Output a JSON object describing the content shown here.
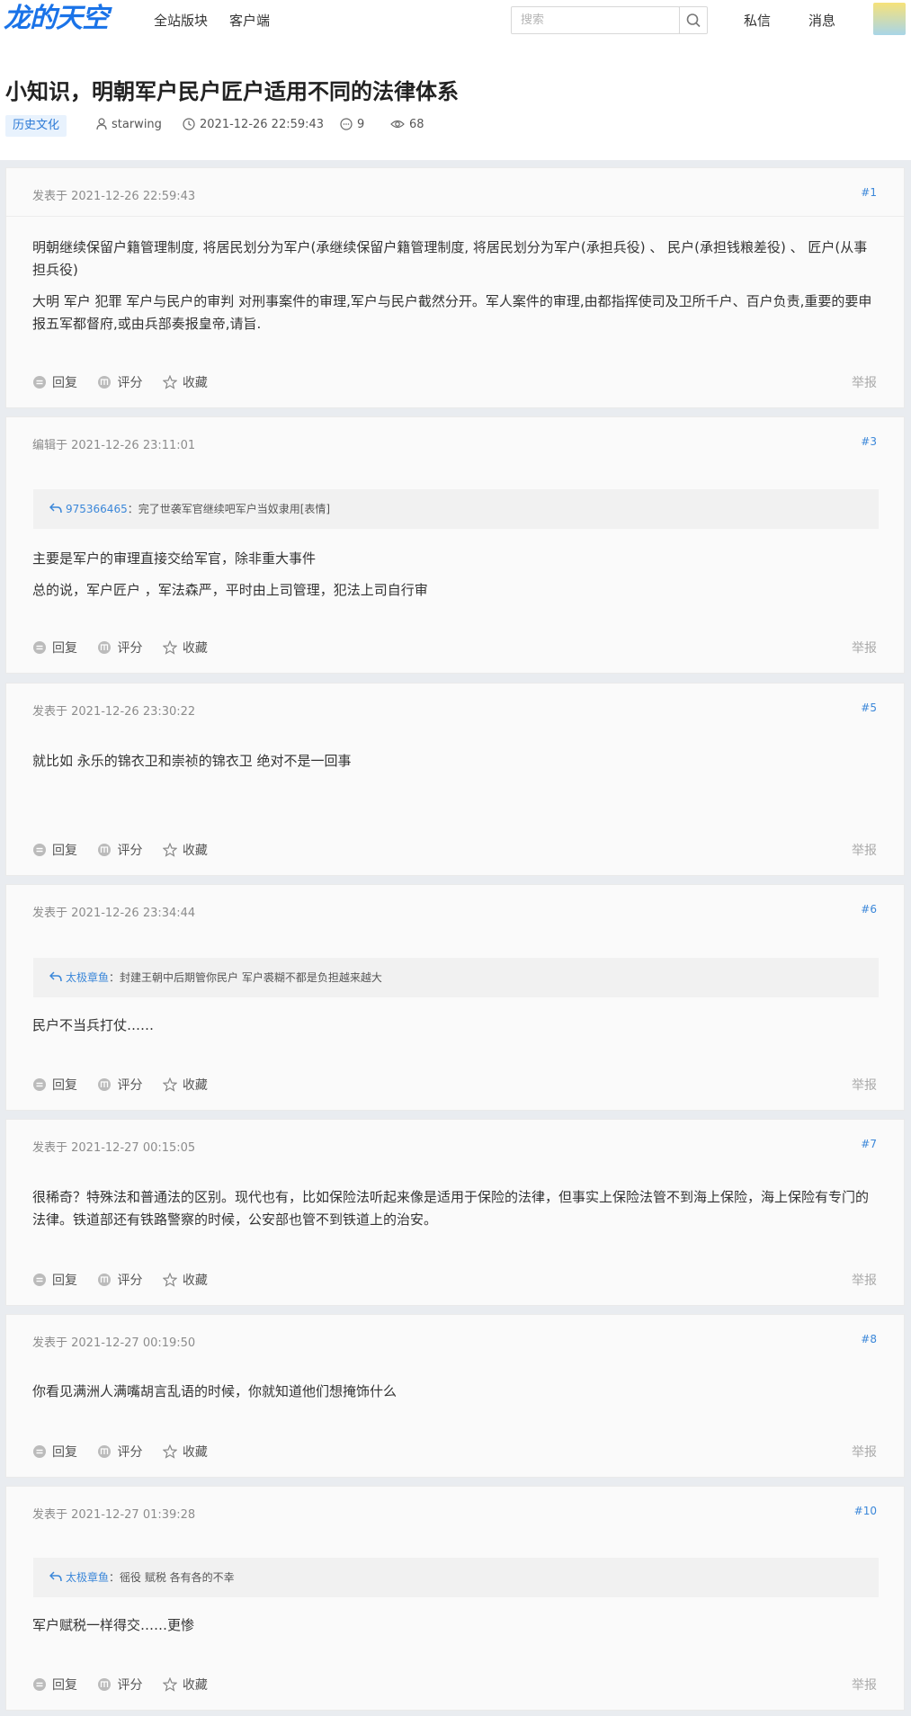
{
  "header": {
    "logo": "龙的天空",
    "nav": [
      "全站版块",
      "客户端"
    ],
    "search_placeholder": "搜索",
    "right_links": [
      "私信",
      "消息"
    ]
  },
  "thread": {
    "title": "小知识，明朝军户民户匠户适用不同的法律体系",
    "tag": "历史文化",
    "author": "starwing",
    "datetime": "2021-12-26 22:59:43",
    "comments": "9",
    "views": "68"
  },
  "labels": {
    "reply": "回复",
    "rate": "评分",
    "favorite": "收藏",
    "report": "举报"
  },
  "posts": [
    {
      "date": "发表于 2021-12-26 22:59:43",
      "floor": "#1",
      "paragraphs": [
        " 明朝继续保留户籍管理制度, 将居民划分为军户(承继续保留户籍管理制度, 将居民划分为军户(承担兵役) 、 民户(承担钱粮差役) 、 匠户(从事担兵役)",
        "大明 军户 犯罪 军户与民户的审判 对刑事案件的审理,军户与民户截然分开。军人案件的审理,由都指挥使司及卫所千户、百户负责,重要的要申报五军都督府,或由兵部奏报皇帝,请旨."
      ]
    },
    {
      "date": "编辑于 2021-12-26 23:11:01",
      "floor": "#3",
      "quote_user": "975366465",
      "quote_text": "：完了世袭军官继续吧军户当奴隶用[表情]",
      "paragraphs": [
        "主要是军户的审理直接交给军官，除非重大事件",
        "总的说，军户匠户 ，军法森严，平时由上司管理，犯法上司自行审"
      ]
    },
    {
      "date": "发表于 2021-12-26 23:30:22",
      "floor": "#5",
      "paragraphs": [
        "就比如 永乐的锦衣卫和崇祯的锦衣卫 绝对不是一回事"
      ]
    },
    {
      "date": "发表于 2021-12-26 23:34:44",
      "floor": "#6",
      "quote_user": "太极章鱼",
      "quote_text": "：封建王朝中后期管你民户 军户裘糊不都是负担越来越大",
      "paragraphs": [
        "民户不当兵打仗……"
      ]
    },
    {
      "date": "发表于 2021-12-27 00:15:05",
      "floor": "#7",
      "paragraphs": [
        "很稀奇？特殊法和普通法的区别。现代也有，比如保险法听起来像是适用于保险的法律，但事实上保险法管不到海上保险，海上保险有专门的法律。铁道部还有铁路警察的时候，公安部也管不到铁道上的治安。"
      ]
    },
    {
      "date": "发表于 2021-12-27 00:19:50",
      "floor": "#8",
      "paragraphs": [
        "你看见满洲人满嘴胡言乱语的时候，你就知道他们想掩饰什么"
      ]
    },
    {
      "date": "发表于 2021-12-27 01:39:28",
      "floor": "#10",
      "quote_user": "太极章鱼",
      "quote_text": "：徭役 赋税 各有各的不幸",
      "paragraphs": [
        "军户赋税一样得交……更惨"
      ]
    }
  ]
}
